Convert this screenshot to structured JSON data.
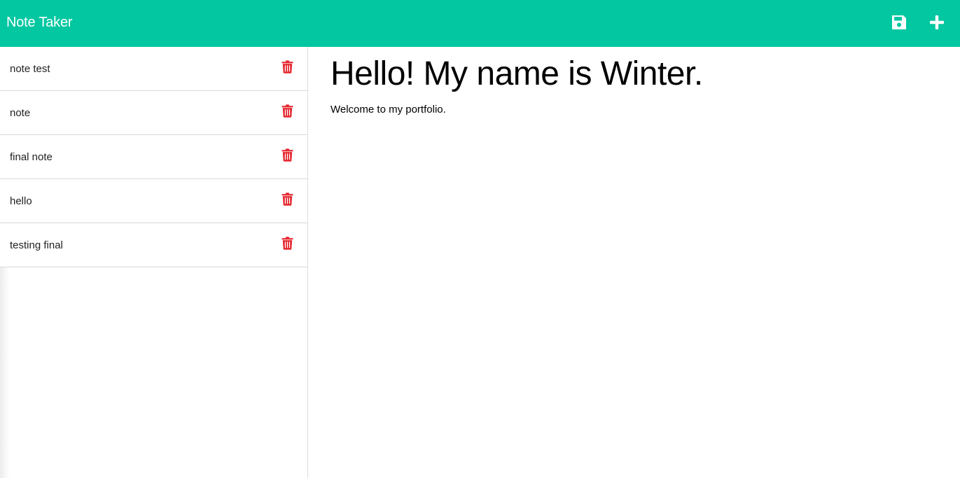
{
  "app": {
    "title": "Note Taker"
  },
  "toolbar": {
    "save_icon": "save-icon",
    "new_icon": "plus-icon"
  },
  "colors": {
    "navbar": "#02c7a1",
    "delete": "#e5232b"
  },
  "notes": [
    {
      "title": "note test"
    },
    {
      "title": "note"
    },
    {
      "title": "final note"
    },
    {
      "title": "hello"
    },
    {
      "title": "testing final"
    }
  ],
  "active_note": {
    "title": "Hello! My name is Winter.",
    "text": "Welcome to my portfolio."
  }
}
